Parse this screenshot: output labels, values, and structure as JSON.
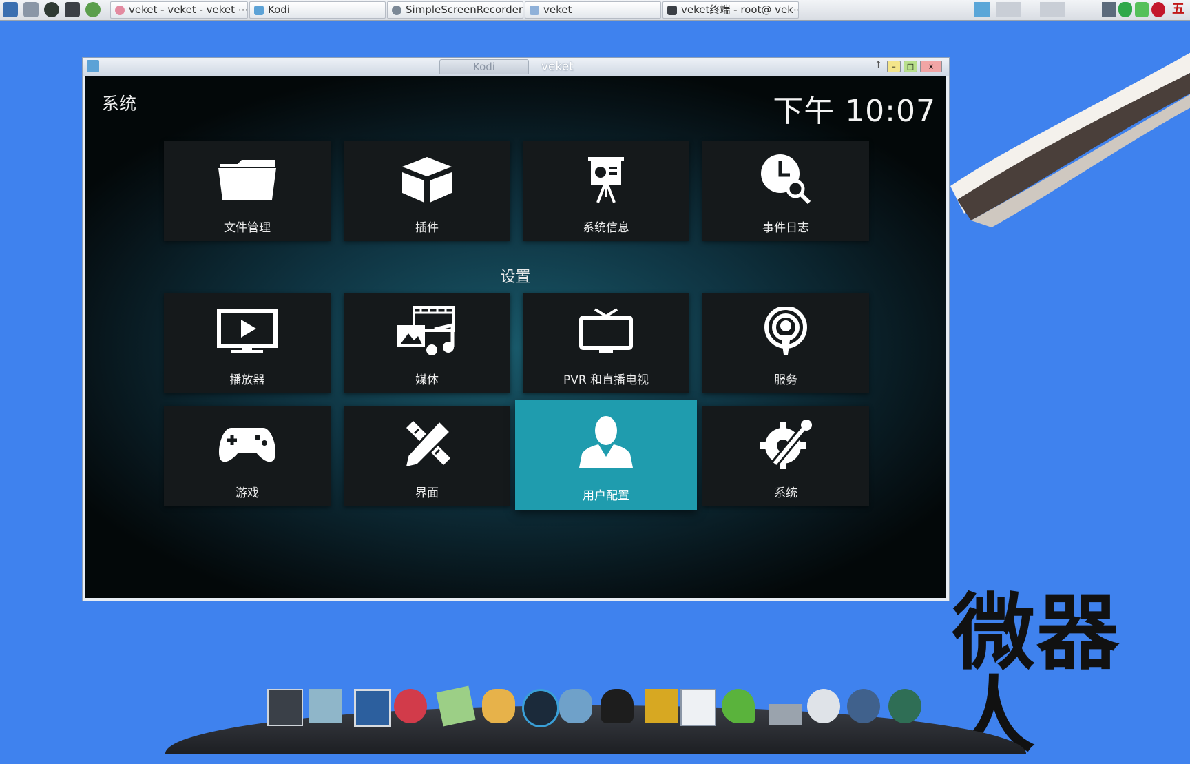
{
  "taskbar": {
    "tasks": [
      {
        "label": "veket - veket - veket ⋯"
      },
      {
        "label": "Kodi"
      },
      {
        "label": "SimpleScreenRecorder"
      },
      {
        "label": "veket"
      },
      {
        "label": "veket终端 - root@ vek⋯"
      }
    ],
    "ime_indicator": "五"
  },
  "window": {
    "tab_label": "Kodi",
    "title": "veket"
  },
  "kodi": {
    "section_title": "系统",
    "clock": "下午 10:07",
    "settings_heading": "设置",
    "top_tiles": [
      {
        "label": "文件管理",
        "icon": "folder-icon"
      },
      {
        "label": "插件",
        "icon": "addon-box-icon"
      },
      {
        "label": "系统信息",
        "icon": "presentation-icon"
      },
      {
        "label": "事件日志",
        "icon": "clock-search-icon"
      }
    ],
    "settings_tiles": [
      {
        "label": "播放器",
        "icon": "player-icon"
      },
      {
        "label": "媒体",
        "icon": "media-icon"
      },
      {
        "label": "PVR 和直播电视",
        "icon": "tv-icon"
      },
      {
        "label": "服务",
        "icon": "broadcast-icon"
      },
      {
        "label": "游戏",
        "icon": "gamepad-icon"
      },
      {
        "label": "界面",
        "icon": "pencil-ruler-icon"
      },
      {
        "label": "用户配置",
        "icon": "user-profile-icon",
        "focused": true
      },
      {
        "label": "系统",
        "icon": "gear-wrench-icon"
      }
    ]
  },
  "desktop": {
    "watermark": "微器人"
  },
  "colors": {
    "desktop": "#3f82ee",
    "tile": "#15191b",
    "focus": "#1f9cae"
  }
}
